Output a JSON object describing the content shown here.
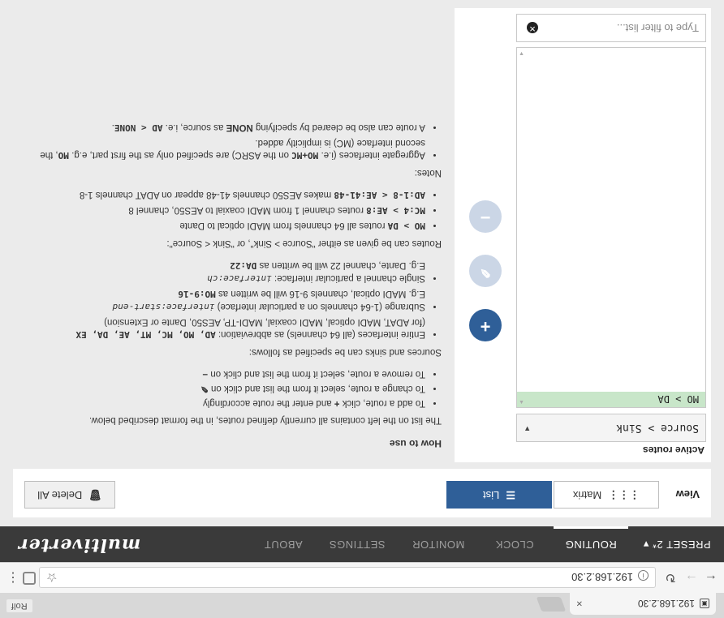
{
  "browser": {
    "tab_title": "192.168.2.30",
    "profile_label": "Rolf",
    "url": "192.168.2.30",
    "menu_label": "⋮"
  },
  "nav": {
    "preset_label": "PRESET 2* ▾",
    "items": [
      "ROUTING",
      "CLOCK",
      "MONITOR",
      "SETTINGS",
      "ABOUT"
    ],
    "active": "ROUTING",
    "brand": "multiverter"
  },
  "toolbar": {
    "view_label": "View",
    "matrix_label": "Matrix",
    "list_label": "List",
    "delete_all_label": "Delete All"
  },
  "routes": {
    "heading": "Active routes",
    "selector_value": "Source > Sink",
    "items": [
      "MO > DA"
    ],
    "filter_placeholder": "Type to filter list..."
  },
  "help": {
    "title": "How to use",
    "intro": "The list on the left contains all currently defined routes, in the format described below.",
    "actions": {
      "add": [
        "To add a route, click",
        "and enter the route accordingly"
      ],
      "change": [
        "To change a route, select it from the list and click on"
      ],
      "remove": [
        "To remove a route, select it from the list and click on"
      ]
    },
    "sources_intro": "Sources and sinks can be specified as follows:",
    "spec": {
      "entire_a": "Entire interfaces (all 64 channels) as abbreviation:",
      "entire_codes": "AD, MO, MC, MT, AE, DA, EX",
      "entire_b": "(for ADAT, MADI optical, MADI coaxial, MADI-TP, AES50, Dante or Extension)",
      "subrange_a": "Subrange (1-64 channels on a particular interface)",
      "subrange_code": "interface:start-end",
      "subrange_eg_a": "E.g. MADI optical, channels 9-16 will be written as",
      "subrange_eg_code": "MO:9-16",
      "single_a": "Single channel a particular interface:",
      "single_code": "interface:ch",
      "single_eg_a": "E.g. Dante, channel 22 will be written as",
      "single_eg_code": "DA:22"
    },
    "routes_intro": "Routes can be given as either \"Source > Sink\", or \"Sink < Source\":",
    "examples": [
      {
        "code": "MO > DA",
        "text": "routes all 64 channels from MADI optical to Dante"
      },
      {
        "code": "MC:4 > AE:8",
        "text": "routes channel 1 from MADI coaxial to AES50, channel 8"
      },
      {
        "code": "AD:1-8 < AE:41-48",
        "text": "makes AES50 channels 41-48 appear on ADAT channels 1-8"
      }
    ],
    "notes_title": "Notes:",
    "notes": {
      "n1_a": "Aggregate interfaces (i.e.",
      "n1_code": "MO+MC",
      "n1_b": "on the ASRC) are specified only as the first part, e.g.",
      "n1_code2": "MO",
      "n1_c": ", the second interface (MC) is implicitly added.",
      "n2_a": "A route can also be cleared by specifying",
      "n2_none": "NONE",
      "n2_b": "as source, i.e.",
      "n2_code": "AD < NONE",
      "n2_c": "."
    }
  },
  "colors": {
    "accent": "#2f5f98",
    "nav_bg": "#3a3a3a",
    "route_item_bg": "#c8e6c9",
    "panel_bg": "#ebebeb"
  }
}
